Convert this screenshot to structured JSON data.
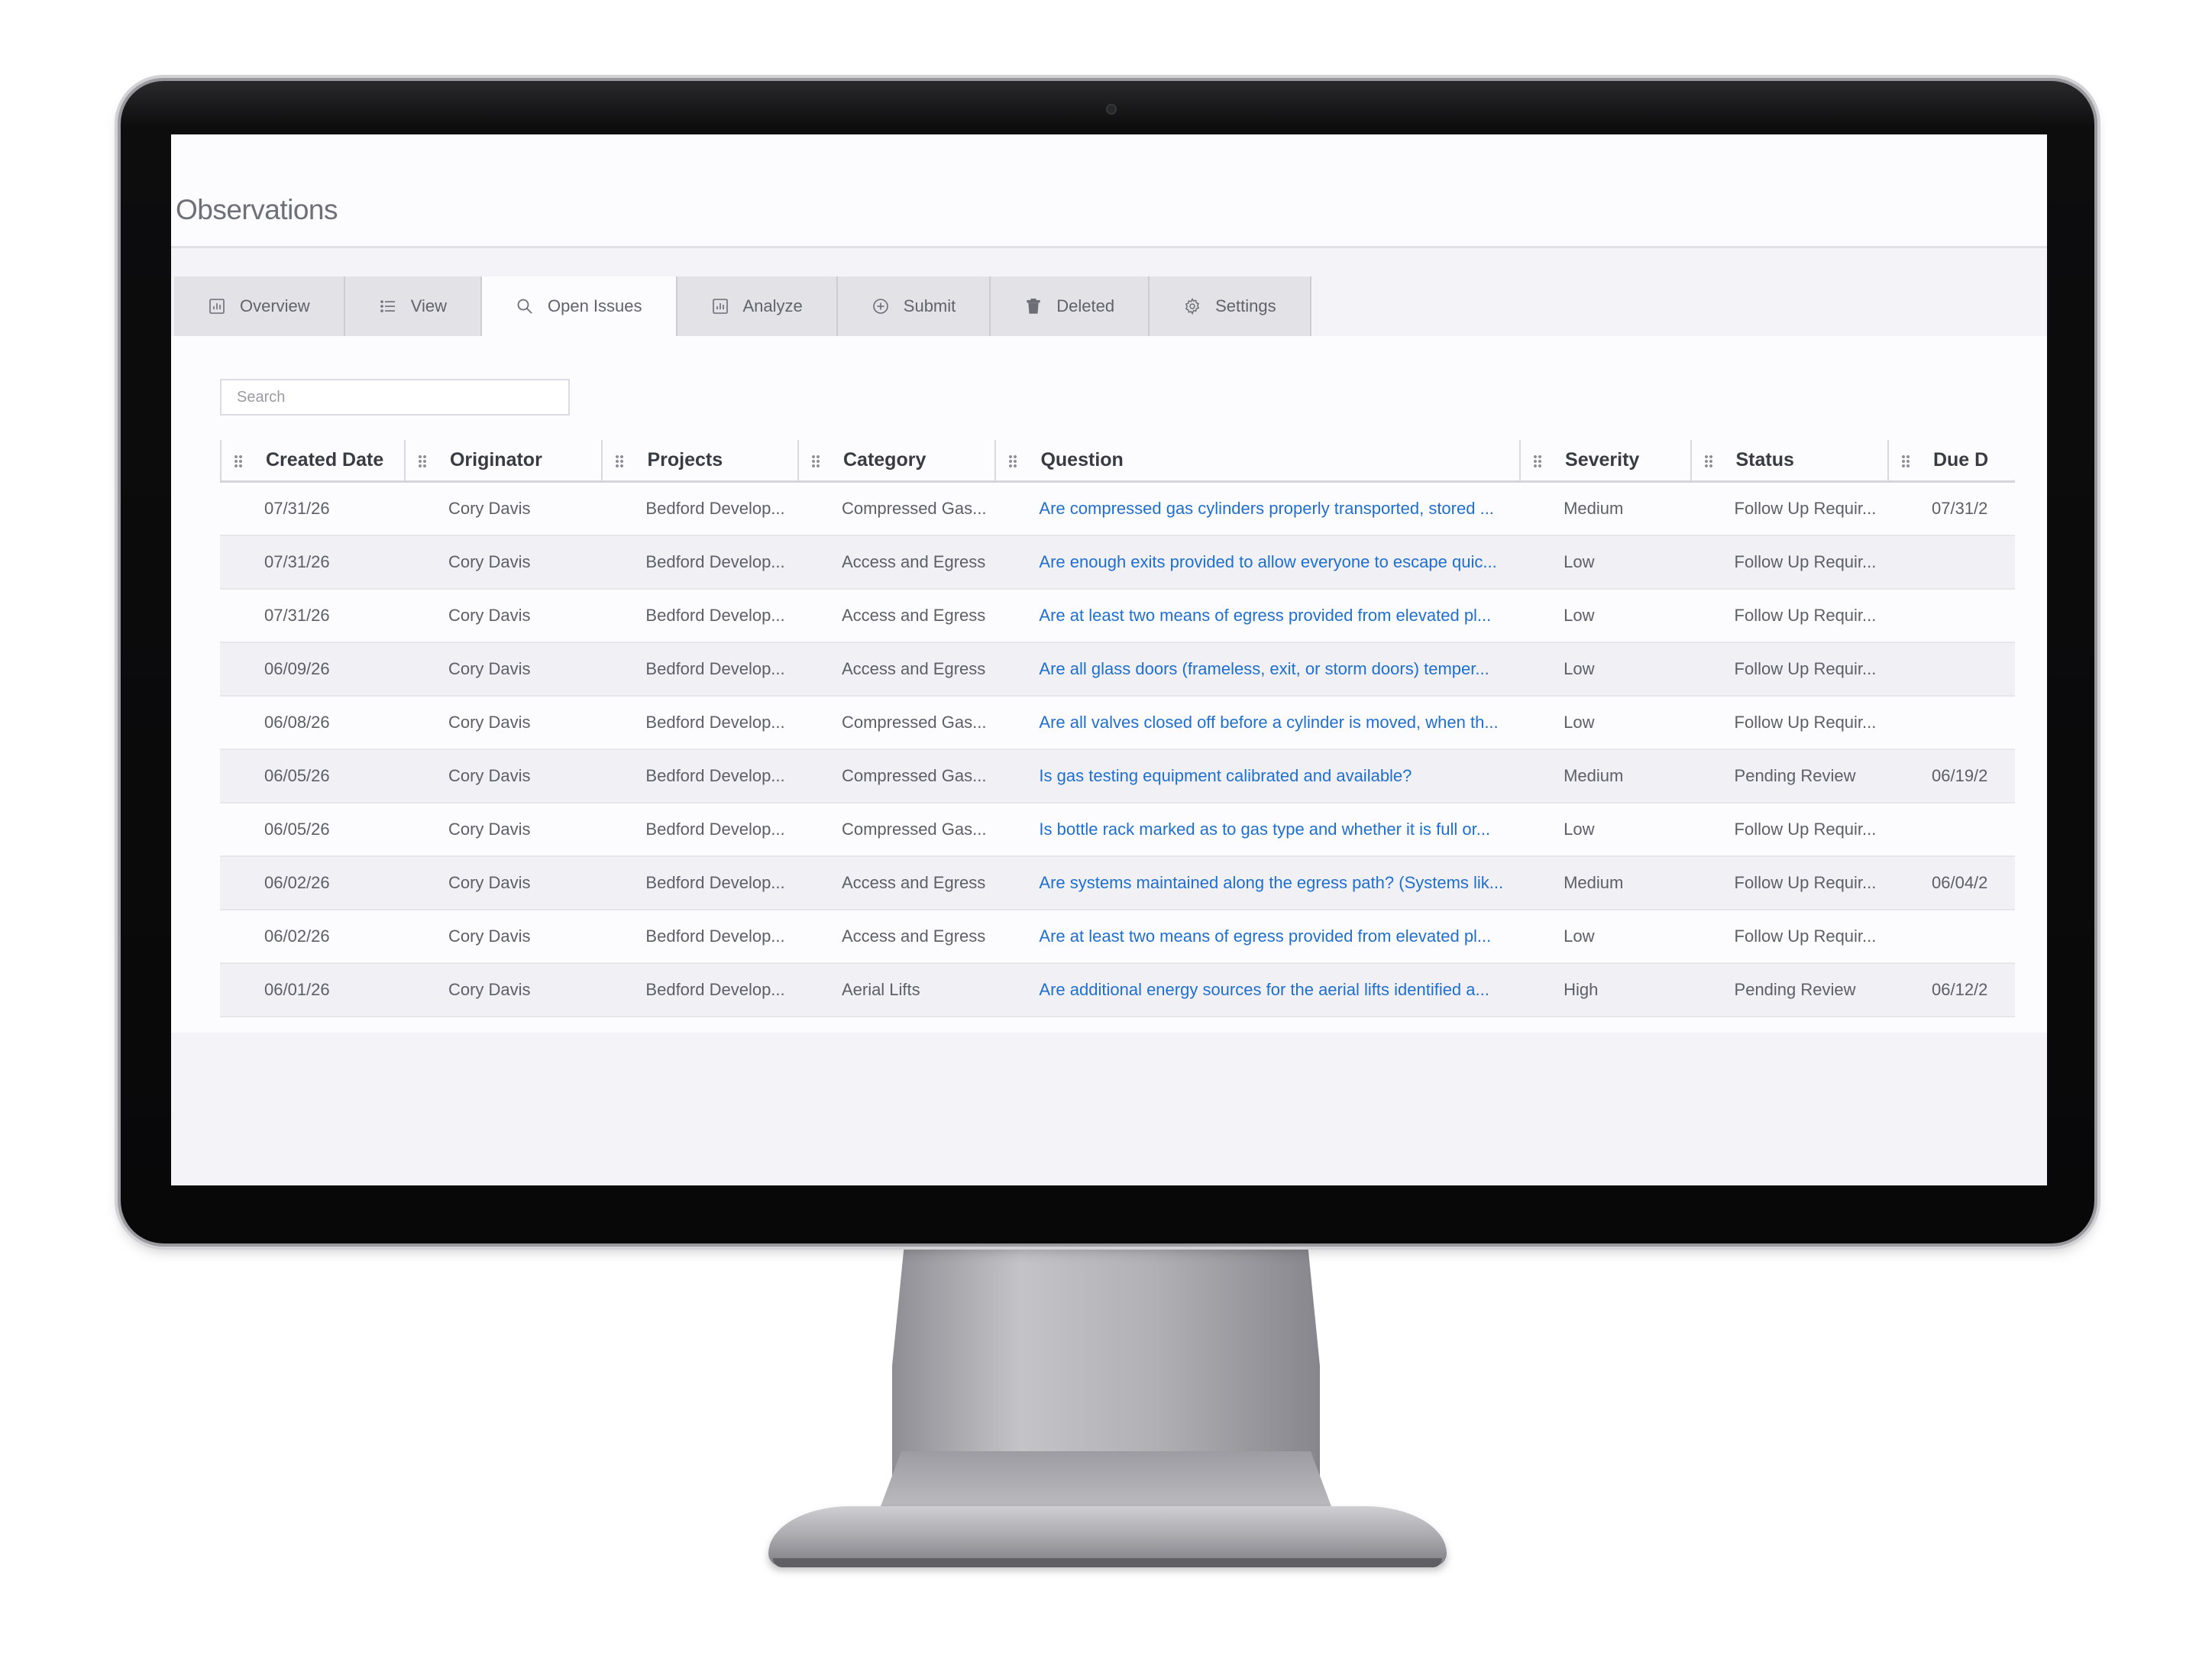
{
  "app": {
    "title": "Observations"
  },
  "tabs": [
    {
      "label": "Overview",
      "icon": "chart-icon"
    },
    {
      "label": "View",
      "icon": "list-icon"
    },
    {
      "label": "Open Issues",
      "icon": "search-icon",
      "active": true
    },
    {
      "label": "Analyze",
      "icon": "chart-icon"
    },
    {
      "label": "Submit",
      "icon": "plus-circle-icon"
    },
    {
      "label": "Deleted",
      "icon": "trash-icon"
    },
    {
      "label": "Settings",
      "icon": "gear-icon"
    }
  ],
  "search": {
    "placeholder": "Search",
    "value": ""
  },
  "table": {
    "columns": [
      "Created Date",
      "Originator",
      "Projects",
      "Category",
      "Question",
      "Severity",
      "Status",
      "Due D"
    ],
    "rows": [
      [
        "07/31/26",
        "Cory Davis",
        "Bedford Develop...",
        "Compressed Gas...",
        "Are compressed gas cylinders properly transported, stored ...",
        "Medium",
        "Follow Up Requir...",
        "07/31/2"
      ],
      [
        "07/31/26",
        "Cory Davis",
        "Bedford Develop...",
        "Access and Egress",
        "Are enough exits provided to allow everyone to escape quic...",
        "Low",
        "Follow Up Requir...",
        ""
      ],
      [
        "07/31/26",
        "Cory Davis",
        "Bedford Develop...",
        "Access and Egress",
        "Are at least two means of egress provided from elevated pl...",
        "Low",
        "Follow Up Requir...",
        ""
      ],
      [
        "06/09/26",
        "Cory Davis",
        "Bedford Develop...",
        "Access and Egress",
        "Are all glass doors (frameless, exit, or storm doors) temper...",
        "Low",
        "Follow Up Requir...",
        ""
      ],
      [
        "06/08/26",
        "Cory Davis",
        "Bedford Develop...",
        "Compressed Gas...",
        "Are all valves closed off before a cylinder is moved, when th...",
        "Low",
        "Follow Up Requir...",
        ""
      ],
      [
        "06/05/26",
        "Cory Davis",
        "Bedford Develop...",
        "Compressed Gas...",
        "Is gas testing equipment calibrated and available?",
        "Medium",
        "Pending Review",
        "06/19/2"
      ],
      [
        "06/05/26",
        "Cory Davis",
        "Bedford Develop...",
        "Compressed Gas...",
        "Is bottle rack marked as to gas type and whether it is full or...",
        "Low",
        "Follow Up Requir...",
        ""
      ],
      [
        "06/02/26",
        "Cory Davis",
        "Bedford Develop...",
        "Access and Egress",
        "Are systems maintained along the egress path? (Systems lik...",
        "Medium",
        "Follow Up Requir...",
        "06/04/2"
      ],
      [
        "06/02/26",
        "Cory Davis",
        "Bedford Develop...",
        "Access and Egress",
        "Are at least two means of egress provided from elevated pl...",
        "Low",
        "Follow Up Requir...",
        ""
      ],
      [
        "06/01/26",
        "Cory Davis",
        "Bedford Develop...",
        "Aerial Lifts",
        "Are additional energy sources for the aerial lifts identified a...",
        "High",
        "Pending Review",
        "06/12/2"
      ]
    ]
  },
  "colors": {
    "link": "#1f6fcf",
    "text": "#5e5e67",
    "header_text": "#3a3a42",
    "tab_bg": "#e3e2e7",
    "active_tab_bg": "#fcfcfe"
  }
}
